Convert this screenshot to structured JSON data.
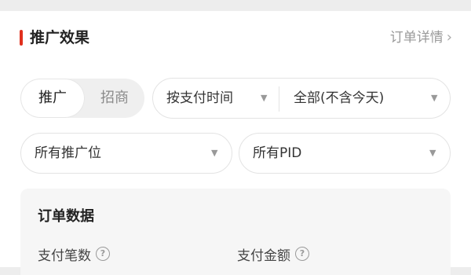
{
  "header": {
    "title": "推广效果",
    "link_label": "订单详情",
    "link_icon": "chevron-right-icon"
  },
  "segment": {
    "options": [
      "推广",
      "招商"
    ],
    "selected": "推广"
  },
  "filters": {
    "time_type": "按支付时间",
    "date_range": "全部(不含今天)",
    "position": "所有推广位",
    "pid": "所有PID"
  },
  "orders": {
    "title": "订单数据",
    "metrics": [
      {
        "label": "支付笔数"
      },
      {
        "label": "支付金额"
      }
    ]
  },
  "colors": {
    "accent": "#e0301e",
    "muted_text": "#9a9a9a",
    "panel_bg": "#f6f6f6"
  }
}
